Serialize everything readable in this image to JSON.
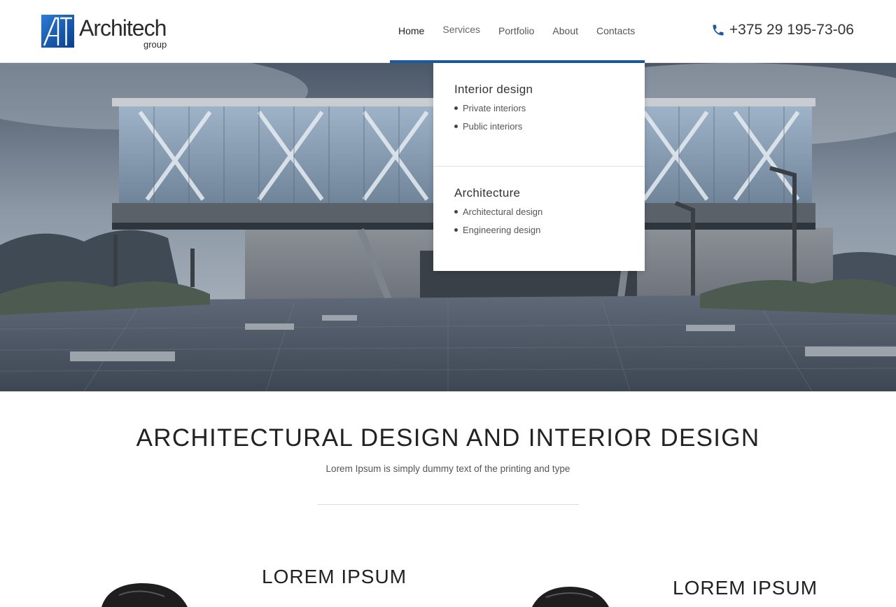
{
  "header": {
    "logo": {
      "name": "Architech",
      "sub": "group"
    },
    "nav": [
      {
        "label": "Home"
      },
      {
        "label": "Services"
      },
      {
        "label": "Portfolio"
      },
      {
        "label": "About"
      },
      {
        "label": "Contacts"
      }
    ],
    "phone": "+375 29 195-73-06"
  },
  "dropdown": {
    "groups": [
      {
        "title": "Interior design",
        "links": [
          "Private interiors",
          "Public interiors"
        ]
      },
      {
        "title": "Architecture",
        "links": [
          "Architectural design",
          "Engineering design"
        ]
      }
    ]
  },
  "intro": {
    "title": "ARCHITECTURAL DESIGN AND INTERIOR DESIGN",
    "subtitle": "Lorem Ipsum is simply dummy text of the printing and type"
  },
  "cards": [
    {
      "title": "LOREM IPSUM"
    },
    {
      "title": "LOREM IPSUM"
    }
  ],
  "colors": {
    "accent": "#1c5aa0",
    "text": "#222222"
  }
}
